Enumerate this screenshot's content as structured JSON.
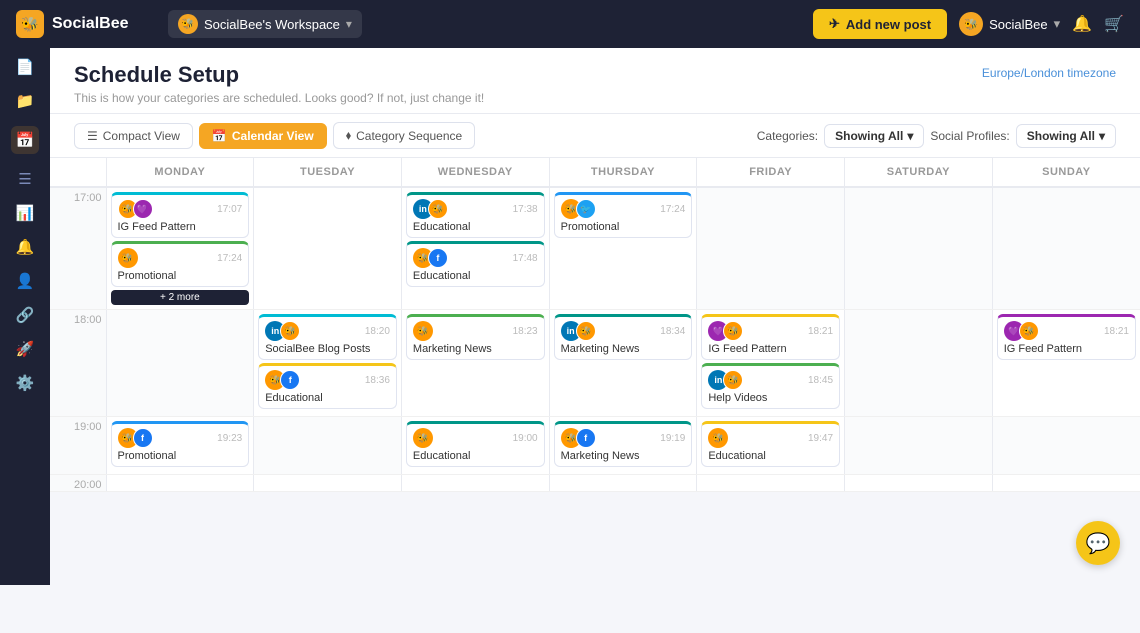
{
  "topnav": {
    "logo_text": "SocialBee",
    "workspace_label": "SocialBee's Workspace",
    "add_post_label": "Add new post",
    "user_label": "SocialBee"
  },
  "page": {
    "title": "Schedule Setup",
    "subtitle": "This is how your categories are scheduled. Looks good? If not, just change it!",
    "timezone": "Europe/London timezone"
  },
  "toolbar": {
    "compact_label": "Compact View",
    "calendar_label": "Calendar View",
    "category_label": "Category Sequence",
    "categories_label": "Categories:",
    "categories_value": "Showing All",
    "profiles_label": "Social Profiles:",
    "profiles_value": "Showing All"
  },
  "calendar": {
    "days": [
      "MONDAY",
      "TUESDAY",
      "WEDNESDAY",
      "THURSDAY",
      "FRIDAY",
      "SATURDAY",
      "SUNDAY"
    ],
    "time_labels": [
      "17:00",
      "18:00",
      "19:00",
      "20:00"
    ],
    "events": {
      "monday_17": [
        {
          "time": "17:07",
          "title": "IG Feed Pattern",
          "color": "cyan",
          "icons": [
            "🐝",
            "💜"
          ]
        },
        {
          "time": "17:24",
          "title": "Promotional",
          "color": "green",
          "icons": [
            "🐝"
          ]
        },
        {
          "more": "+2 more"
        }
      ],
      "tuesday_17": [],
      "wednesday_17": [
        {
          "time": "17:38",
          "title": "Educational",
          "color": "teal",
          "icons": [
            "in",
            "🐝"
          ]
        },
        {
          "time": "17:48",
          "title": "Educational",
          "color": "teal",
          "icons": [
            "🐝",
            "f"
          ]
        }
      ],
      "thursday_17": [
        {
          "time": "17:24",
          "title": "Promotional",
          "color": "blue",
          "icons": [
            "🐝",
            "💙"
          ]
        }
      ],
      "friday_17": [],
      "saturday_17": [],
      "sunday_17": [],
      "monday_18": [],
      "tuesday_18": [
        {
          "time": "18:20",
          "title": "SocialBee Blog Posts",
          "color": "cyan",
          "icons": [
            "in",
            "🐝"
          ]
        },
        {
          "time": "18:36",
          "title": "Educational",
          "color": "yellow",
          "icons": [
            "🐝",
            "f"
          ]
        }
      ],
      "wednesday_18": [
        {
          "time": "18:23",
          "title": "Marketing News",
          "color": "green",
          "icons": [
            "🐝"
          ]
        }
      ],
      "thursday_18": [
        {
          "time": "18:34",
          "title": "Marketing News",
          "color": "teal",
          "icons": [
            "in",
            "🐝"
          ]
        }
      ],
      "friday_18": [
        {
          "time": "18:21",
          "title": "IG Feed Pattern",
          "color": "yellow",
          "icons": [
            "💜",
            "🐝"
          ]
        },
        {
          "time": "18:45",
          "title": "Help Videos",
          "color": "green",
          "icons": [
            "in",
            "🐝"
          ]
        }
      ],
      "saturday_18": [],
      "sunday_18": [
        {
          "time": "18:21",
          "title": "IG Feed Pattern",
          "color": "purple",
          "icons": [
            "💜",
            "🐝"
          ]
        }
      ],
      "monday_19": [
        {
          "time": "19:23",
          "title": "Promotional",
          "color": "blue",
          "icons": [
            "🐝",
            "f"
          ]
        }
      ],
      "tuesday_19": [],
      "wednesday_19": [
        {
          "time": "19:00",
          "title": "Educational",
          "color": "teal",
          "icons": [
            "🐝"
          ]
        }
      ],
      "thursday_19": [
        {
          "time": "19:19",
          "title": "Marketing News",
          "color": "teal",
          "icons": [
            "🐝",
            "f"
          ]
        }
      ],
      "friday_19": [
        {
          "time": "19:47",
          "title": "Educational",
          "color": "yellow",
          "icons": [
            "🐝"
          ]
        }
      ],
      "saturday_19": [],
      "sunday_19": []
    }
  },
  "sidebar": {
    "icons": [
      "📄",
      "📁",
      "📅",
      "☰",
      "📊",
      "🔔",
      "👤",
      "🔗",
      "🚀",
      "⚙️"
    ]
  }
}
